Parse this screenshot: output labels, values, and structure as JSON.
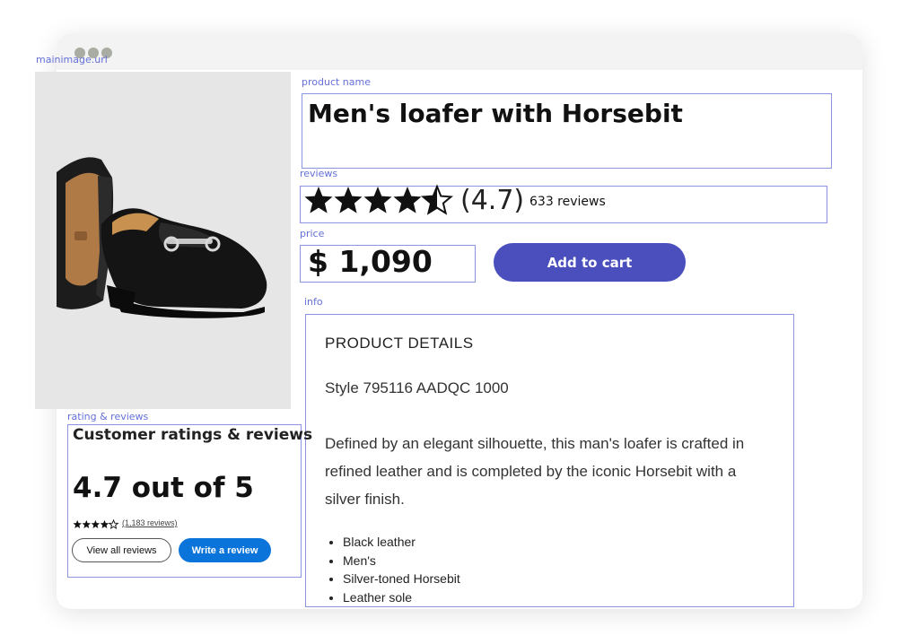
{
  "labels": {
    "main_image": "mainimage.url",
    "product_name": "product name",
    "reviews": "reviews",
    "price": "price",
    "info": "info",
    "rating_reviews": "rating & reviews"
  },
  "product": {
    "name": "Men's loafer with Horsebit",
    "rating": "(4.7)",
    "rating_value": 4.7,
    "review_count": "633 reviews",
    "price": "$ 1,090",
    "add_to_cart": "Add to cart"
  },
  "ratings": {
    "title": "Customer ratings & reviews",
    "score": "4.7 out of 5",
    "link": "(1,183 reviews)",
    "view_all": "View all reviews",
    "write": "Write a review"
  },
  "details": {
    "heading": "PRODUCT DETAILS",
    "style": "Style 795116 AADQC 1000",
    "description": "Defined by an elegant silhouette, this man's loafer is crafted in refined leather and is completed by the iconic Horsebit with a silver finish.",
    "bullets": [
      "Black leather",
      "Men's",
      "Silver-toned Horsebit",
      "Leather sole"
    ]
  },
  "colors": {
    "accent": "#4b4fbd",
    "link_blue": "#0a74da",
    "box_border": "#8b93e3",
    "label": "#6470d8"
  }
}
